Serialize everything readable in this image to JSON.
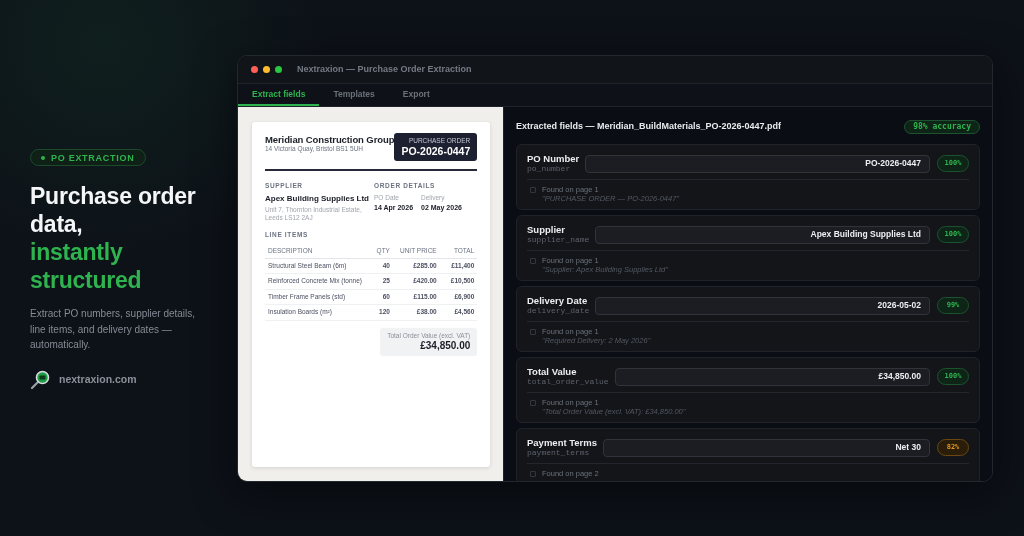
{
  "hero": {
    "badge": "PO EXTRACTION",
    "headline": "Purchase order data,",
    "headline_highlight": "instantly structured",
    "description": "Extract PO numbers, supplier details, line items, and delivery dates — automatically.",
    "site": "nextraxion.com"
  },
  "window": {
    "title": "Nextraxion — Purchase Order Extraction"
  },
  "tabs": [
    {
      "label": "Extract fields",
      "selected": true
    },
    {
      "label": "Templates",
      "selected": false
    },
    {
      "label": "Export",
      "selected": false
    }
  ],
  "document": {
    "company": "Meridian Construction Group",
    "address": "14 Victoria Quay, Bristol BS1 5UH",
    "badge_label": "PURCHASE ORDER",
    "po_number": "PO-2026-0447",
    "supplier_heading": "SUPPLIER",
    "supplier_name": "Apex Building Supplies Ltd",
    "supplier_address": "Unit 7, Thornton Industrial Estate, Leeds LS12 2AJ",
    "order_heading": "ORDER DETAILS",
    "details": [
      {
        "label": "PO Date",
        "value": "14 Apr 2026"
      },
      {
        "label": "Delivery",
        "value": "02 May 2026"
      }
    ],
    "line_items_heading": "LINE ITEMS",
    "table": {
      "columns": [
        "DESCRIPTION",
        "QTY",
        "UNIT PRICE",
        "TOTAL"
      ],
      "rows": [
        [
          "Structural Steel Beam (6m)",
          "40",
          "£285.00",
          "£11,400"
        ],
        [
          "Reinforced Concrete Mix (tonne)",
          "25",
          "£420.00",
          "£10,500"
        ],
        [
          "Timber Frame Panels (std)",
          "60",
          "£115.00",
          "£6,900"
        ],
        [
          "Insulation Boards (m²)",
          "120",
          "£38.00",
          "£4,560"
        ]
      ]
    },
    "total_label": "Total Order Value (excl. VAT)",
    "total_value": "£34,850.00"
  },
  "extraction": {
    "title": "Extracted fields — Meridian_BuildMaterials_PO-2026-0447.pdf",
    "accuracy": "98% accuracy",
    "fields": [
      {
        "label": "PO Number",
        "key": "po_number",
        "value": "PO-2026-0447",
        "confidence": "100%",
        "kind": "high",
        "source": "Found on page 1",
        "quote": "\"PURCHASE ORDER — PO-2026-0447\""
      },
      {
        "label": "Supplier",
        "key": "supplier_name",
        "value": "Apex Building Supplies Ltd",
        "confidence": "100%",
        "kind": "high",
        "source": "Found on page 1",
        "quote": "\"Supplier: Apex Building Supplies Ltd\""
      },
      {
        "label": "Delivery Date",
        "key": "delivery_date",
        "value": "2026-05-02",
        "confidence": "99%",
        "kind": "high",
        "source": "Found on page 1",
        "quote": "\"Required Delivery: 2 May 2026\""
      },
      {
        "label": "Total Value",
        "key": "total_order_value",
        "value": "£34,850.00",
        "confidence": "100%",
        "kind": "high",
        "source": "Found on page 1",
        "quote": "\"Total Order Value (excl. VAT): £34,850.00\""
      },
      {
        "label": "Payment Terms",
        "key": "payment_terms",
        "value": "Net 30",
        "confidence": "82%",
        "kind": "medium",
        "source": "Found on page 2"
      }
    ]
  }
}
